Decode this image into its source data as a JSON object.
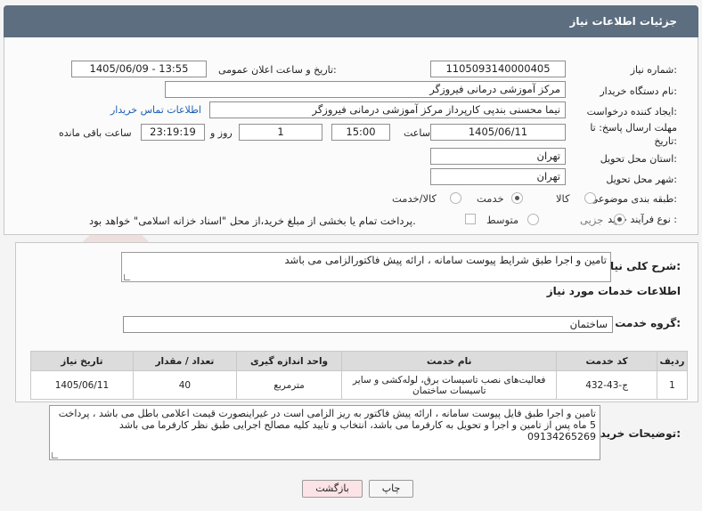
{
  "page": {
    "title": "جزئیات اطلاعات نیاز"
  },
  "form": {
    "need_number": {
      "label": "شماره نیاز:",
      "value": "1105093140000405"
    },
    "announce_datetime": {
      "label": "تاریخ و ساعت اعلان عمومی:",
      "value": "1405/06/09 - 13:55"
    },
    "buyer_org": {
      "label": "نام دستگاه خریدار:",
      "value": "مرکز آموزشی درمانی فیروزگر"
    },
    "request_creator": {
      "label": "ایجاد کننده درخواست:",
      "value": "نیما محسنی بندپی کارپرداز مرکز آموزشی درمانی فیروزگر",
      "contact_link": "اطلاعات تماس خریدار"
    },
    "deadline": {
      "label": "مهلت ارسال پاسخ: تا تاریخ:",
      "date": "1405/06/11",
      "time_label": "ساعت",
      "time": "15:00",
      "days": "1",
      "days_label": "روز و",
      "remaining": "23:19:19",
      "remaining_label": "ساعت باقی مانده"
    },
    "delivery_province": {
      "label": "استان محل تحویل:",
      "value": "تهران"
    },
    "delivery_city": {
      "label": "شهر محل تحویل:",
      "value": "تهران"
    },
    "category": {
      "label": "طبقه بندی موضوعی:",
      "options": [
        "کالا",
        "خدمت",
        "کالا/خدمت"
      ],
      "selected": "خدمت"
    },
    "purchase_type": {
      "label": "نوع فرآیند خرید :",
      "options": [
        "جزیی",
        "متوسط"
      ],
      "selected": "جزیی",
      "treasury_note": "پرداخت تمام یا بخشی از مبلغ خرید،از محل \"اسناد خزانه اسلامی\" خواهد بود."
    }
  },
  "description": {
    "label": "شرح کلی نیاز:",
    "value": "تامین و اجرا طبق شرایط پیوست سامانه ، ارائه پیش فاکتورالزامی می باشد"
  },
  "services": {
    "section_title": "اطلاعات خدمات مورد نیاز",
    "group_label": "گروه خدمت:",
    "group_value": "ساختمان",
    "table": {
      "headers": [
        "ردیف",
        "کد خدمت",
        "نام خدمت",
        "واحد اندازه گیری",
        "تعداد / مقدار",
        "تاریخ نیاز"
      ],
      "rows": [
        [
          "1",
          "ج-43-432",
          "فعالیت‌های نصب تاسیسات برق، لوله‌کشی و سایر تاسیسات ساختمان",
          "مترمربع",
          "40",
          "1405/06/11"
        ]
      ]
    }
  },
  "buyer_notes": {
    "label": "توضیحات خریدار:",
    "value": "تامین و اجرا طبق فایل پیوست سامانه ، ارائه پیش فاکتور به ریز الزامی است در غیراینصورت قیمت اعلامی باطل می باشد ، پرداخت 5 ماه پس از تامین و اجرا و تحویل به کارفرما می باشد، انتخاب و تایید کلیه مصالح اجرایی طبق نظر کارفرما می باشد 09134265269"
  },
  "buttons": {
    "print": "چاپ",
    "back": "بازگشت"
  },
  "watermark": {
    "text": "AriaTender.net"
  },
  "colors": {
    "header": "#5c6e80",
    "link": "#1a5fb4",
    "back_button": "#fbe3e6"
  }
}
